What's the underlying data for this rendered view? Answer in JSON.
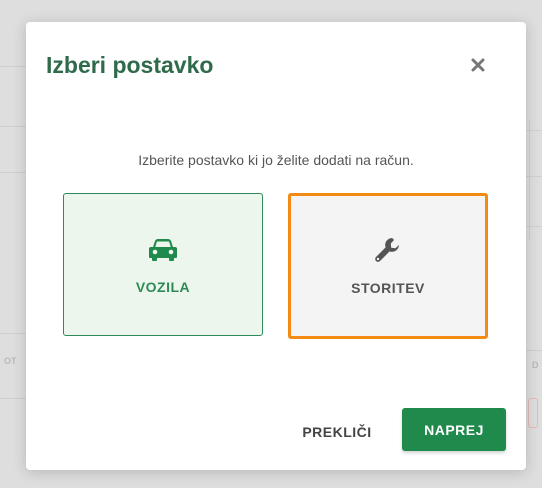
{
  "dialog": {
    "title": "Izberi postavko",
    "close_icon": "close-icon",
    "instruction": "Izberite postavko ki jo želite dodati na račun.",
    "options": [
      {
        "label": "VOZILA",
        "icon": "car-icon",
        "color": "#2e8b57"
      },
      {
        "label": "STORITEV",
        "icon": "wrench-icon",
        "color": "#555555",
        "highlight": "#f28a14"
      }
    ],
    "cancel_label": "PREKLIČI",
    "next_label": "NAPREJ",
    "accent_color": "#1f8a4c"
  },
  "background": {
    "fragments": [
      "OT",
      "D"
    ]
  }
}
